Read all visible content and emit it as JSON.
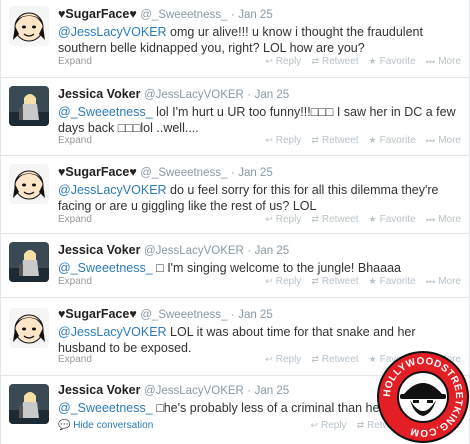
{
  "tweets": [
    {
      "name": "♥SugarFace♥",
      "handle": "@_Sweeetness_",
      "dot": "·",
      "time": "Jan 25",
      "mention": "@JessLacyVOKER",
      "text": " omg ur alive!!! u know i thought the fraudulent southern belle kidnapped you, right? LOL how are you?",
      "expand": "Expand",
      "avatar": "sugarface-avatar"
    },
    {
      "name": "Jessica Voker",
      "handle": "@JessLacyVOKER",
      "dot": "·",
      "time": "Jan 25",
      "mention": "@_Sweeetness_",
      "text": " lol I'm hurt u UR too funny!!!□□□ I saw her in DC a few days back □□□lol ..well....",
      "expand": "Expand",
      "avatar": "jessica-avatar"
    },
    {
      "name": "♥SugarFace♥",
      "handle": "@_Sweeetness_",
      "dot": "·",
      "time": "Jan 25",
      "mention": "@JessLacyVOKER",
      "text": " do u feel sorry for this for all this dilemma they're facing or are u giggling like the rest of us? LOL",
      "expand": "Expand",
      "avatar": "sugarface-avatar"
    },
    {
      "name": "Jessica Voker",
      "handle": "@JessLacyVOKER",
      "dot": "·",
      "time": "Jan 25",
      "mention": "@_Sweeetness_",
      "text": " □ I'm singing welcome to the jungle! Bhaaaa",
      "expand": "Expand",
      "avatar": "jessica-avatar"
    },
    {
      "name": "♥SugarFace♥",
      "handle": "@_Sweeetness_",
      "dot": "·",
      "time": "Jan 25",
      "mention": "@JessLacyVOKER",
      "text": " LOL it was about time for that snake and her husband to be exposed.",
      "expand": "Expand",
      "avatar": "sugarface-avatar"
    },
    {
      "name": "Jessica Voker",
      "handle": "@JessLacyVOKER",
      "dot": "·",
      "time": "Jan 25",
      "mention": "@_Sweeetness_",
      "text": " □he's probably less of a criminal than her! Real",
      "expand": "Hide conversation",
      "avatar": "jessica-avatar"
    }
  ],
  "actions": {
    "reply": "Reply",
    "retweet": "Retweet",
    "favorite": "Favorite",
    "more": "More",
    "reply_icon": "reply-icon",
    "retweet_icon": "retweet-icon",
    "favorite_icon": "star-icon",
    "more_icon": "more-dots-icon"
  },
  "badge": {
    "text": "HOLLYWOODSTREETKING.COM",
    "colors": {
      "ring": "#e31e24",
      "inner": "#ffffff",
      "outline": "#111111"
    }
  },
  "colors": {
    "link": "#2b7bb9",
    "meta": "#8899a6",
    "action": "#b8c3cc",
    "divider": "#e6e6e6"
  }
}
